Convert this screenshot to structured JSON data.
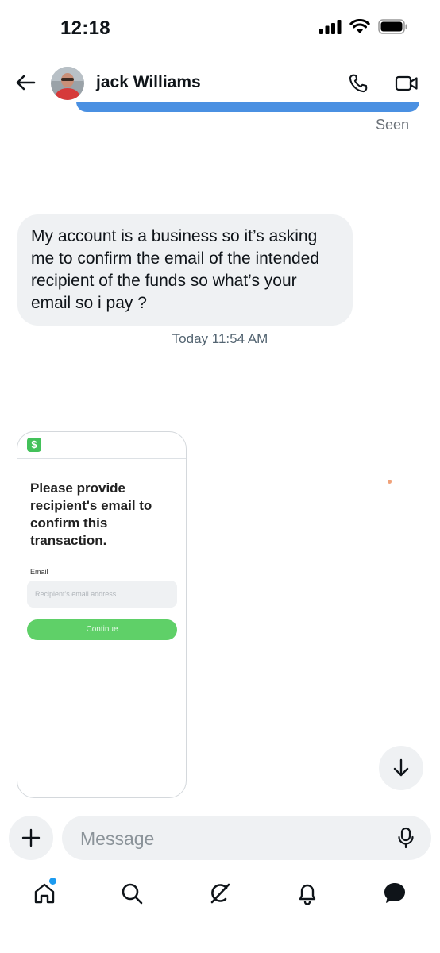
{
  "status_bar": {
    "time": "12:18"
  },
  "header": {
    "contact_name": "jack Williams"
  },
  "conversation": {
    "seen_label": "Seen",
    "received_message": "My account is a business so it’s asking me to confirm the email of the intended recipient of the funds so what’s your email so i pay ?",
    "timestamp": "Today 11:54 AM",
    "image_card": {
      "logo_glyph": "$",
      "title": "Please provide recipient's email to confirm this transaction.",
      "email_label": "Email",
      "email_placeholder": "Recipient's email address",
      "email_value": "",
      "continue_label": "Continue",
      "brand_color": "#43c15a"
    }
  },
  "composer": {
    "placeholder": "Message",
    "value": ""
  },
  "nav": {
    "items": [
      "home-icon",
      "search-icon",
      "grok-icon",
      "notifications-icon",
      "messages-icon"
    ],
    "home_has_notification": true
  },
  "colors": {
    "accent": "#1d9bf0",
    "sent_bubble": "#4a90e2",
    "received_bubble": "#eff1f3"
  }
}
